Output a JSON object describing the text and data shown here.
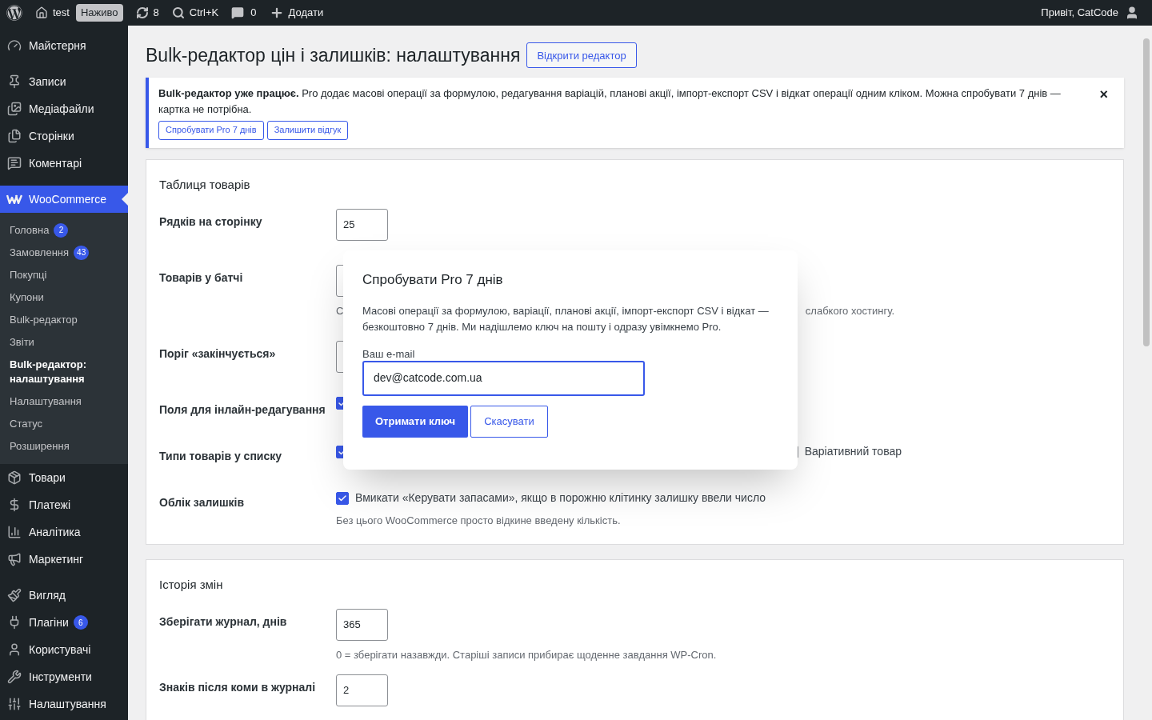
{
  "admin_bar": {
    "site": "test",
    "live_badge": "Наживо",
    "updates": "8",
    "search_shortcut": "Ctrl+K",
    "comments": "0",
    "add_new": "Додати",
    "greeting": "Привіт, CatCode"
  },
  "sidebar": {
    "items": [
      {
        "label": "Майстерня",
        "selected": false
      },
      {
        "label": "Записи",
        "selected": false
      },
      {
        "label": "Медіафайли",
        "selected": false
      },
      {
        "label": "Сторінки",
        "selected": false
      },
      {
        "label": "Коментарі",
        "selected": false
      },
      {
        "label": "WooCommerce",
        "selected": true,
        "children": [
          {
            "label": "Головна",
            "badge": "2",
            "selected": false
          },
          {
            "label": "Замовлення",
            "badge": "43",
            "selected": false
          },
          {
            "label": "Покупці",
            "selected": false
          },
          {
            "label": "Купони",
            "selected": false
          },
          {
            "label": "Bulk-редактор",
            "selected": false
          },
          {
            "label": "Звіти",
            "selected": false
          },
          {
            "label": "Bulk-редактор: налаштування",
            "selected": true
          },
          {
            "label": "Налаштування",
            "selected": false
          },
          {
            "label": "Статус",
            "selected": false
          },
          {
            "label": "Розширення",
            "selected": false
          }
        ]
      },
      {
        "label": "Товари",
        "selected": false
      },
      {
        "label": "Платежі",
        "selected": false
      },
      {
        "label": "Аналітика",
        "selected": false
      },
      {
        "label": "Маркетинг",
        "selected": false
      },
      {
        "label": "Вигляд",
        "selected": false
      },
      {
        "label": "Плагіни",
        "badge": "6",
        "selected": false
      },
      {
        "label": "Користувачі",
        "selected": false
      },
      {
        "label": "Інструменти",
        "selected": false
      },
      {
        "label": "Налаштування",
        "selected": false
      }
    ]
  },
  "page": {
    "title": "Bulk-редактор цін і залишків: налаштування",
    "open_editor_button": "Відкрити редактор"
  },
  "notice": {
    "text": "**Bulk-редактор уже працює.** Pro додає масові операції за формулою, редагування варіацій, планові акції, імпорт-експорт CSV і відкат операції одним кліком. Можна спробувати 7 днів — картка не потрібна.",
    "buttons": [
      "Спробувати Pro 7 днів",
      "Залишити відгук"
    ],
    "dismiss": "×"
  },
  "sections": [
    {
      "title": "Таблиця товарів",
      "rows": [
        {
          "kind": "number",
          "label": "Рядків на сторінку",
          "value": "25"
        },
        {
          "kind": "number",
          "label": "Товарів у батчі",
          "hint_start": "С",
          "hint_end": "слабкого хостингу."
        },
        {
          "kind": "number",
          "label": "Поріг «закінчується»"
        },
        {
          "kind": "checks",
          "label": "Поля для інлайн-редагування",
          "items": [
            {
              "checked": true
            }
          ]
        },
        {
          "kind": "checks",
          "label": "Типи товарів у списку",
          "items": [
            {
              "checked": true
            },
            {
              "checked": false,
              "label": "Варіативний товар"
            }
          ]
        },
        {
          "kind": "checks",
          "label": "Облік залишків",
          "items": [
            {
              "checked": true,
              "label": "Вмикати «Керувати запасами», якщо в порожню клітинку залишку ввели число"
            }
          ],
          "hint": "Без цього WooCommerce просто відкине введену кількість."
        }
      ]
    },
    {
      "title": "Історія змін",
      "rows": [
        {
          "kind": "number",
          "label": "Зберігати журнал, днів",
          "value": "365",
          "hint": "0 = зберігати назавжди. Старіші записи прибирає щоденне завдання WP-Cron."
        },
        {
          "kind": "number",
          "label": "Знаків після коми в журналі",
          "value": "2"
        }
      ]
    }
  ],
  "modal": {
    "title": "Спробувати Pro 7 днів",
    "text": "Масові операції за формулою, варіації, планові акції, імпорт-експорт CSV і відкат — безкоштовно 7 днів. Ми надішлемо ключ на пошту і одразу увімкнемо Pro.",
    "email_label": "Ваш e-mail",
    "email_value": "dev@catcode.com.ua",
    "submit": "Отримати ключ",
    "cancel": "Скасувати"
  }
}
